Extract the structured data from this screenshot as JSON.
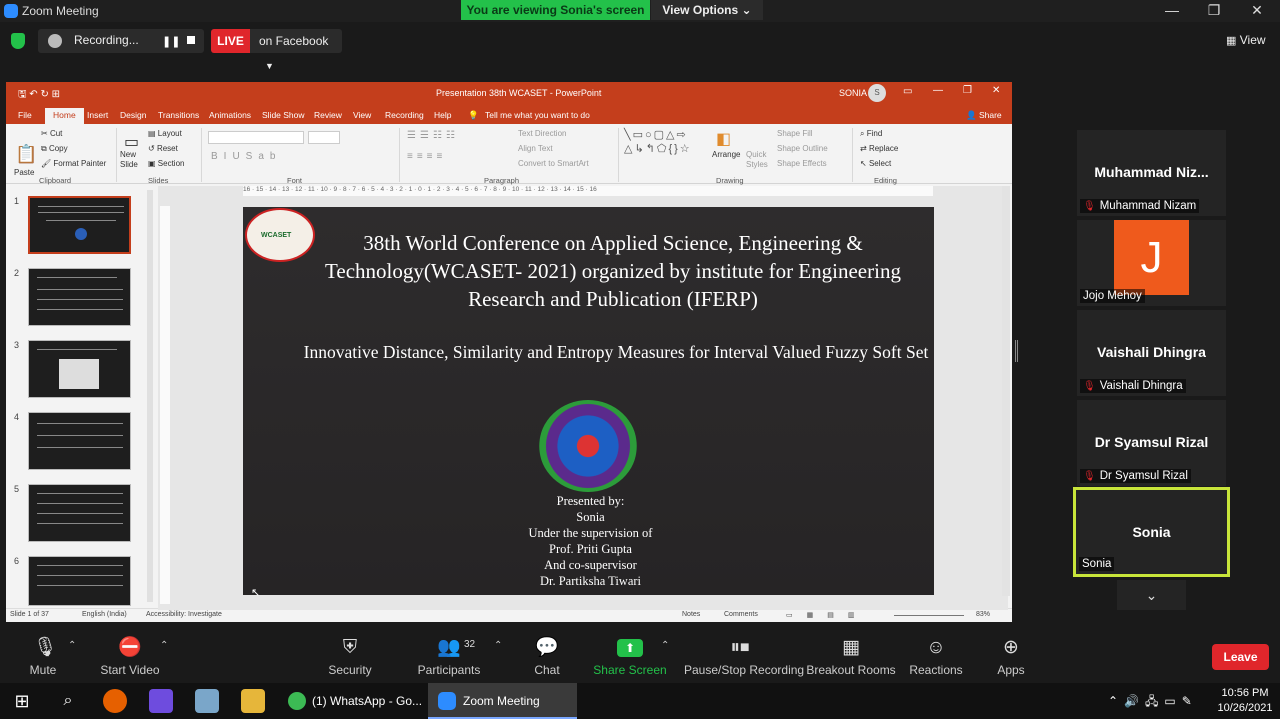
{
  "window": {
    "title": "Zoom Meeting"
  },
  "banner": {
    "viewing": "You are viewing Sonia's screen",
    "view_options": "View Options"
  },
  "status": {
    "recording": "Recording...",
    "live": "LIVE",
    "destination": "on Facebook",
    "view": "View"
  },
  "ppt": {
    "title": "Presentation 38th WCASET  -  PowerPoint",
    "user": "SONIA",
    "user_initial": "S",
    "tabs": [
      "File",
      "Home",
      "Insert",
      "Design",
      "Transitions",
      "Animations",
      "Slide Show",
      "Review",
      "View",
      "Recording",
      "Help"
    ],
    "tell_me": "Tell me what you want to do",
    "share": "Share",
    "ribbon": {
      "paste": "Paste",
      "cut": "Cut",
      "copy": "Copy",
      "format_painter": "Format Painter",
      "new_slide": "New Slide",
      "layout": "Layout",
      "reset": "Reset",
      "section": "Section",
      "text_direction": "Text Direction",
      "align_text": "Align Text",
      "convert_smartart": "Convert to SmartArt",
      "arrange": "Arrange",
      "quick_styles": "Quick Styles",
      "shape_fill": "Shape Fill",
      "shape_outline": "Shape Outline",
      "shape_effects": "Shape Effects",
      "find": "Find",
      "replace": "Replace",
      "select": "Select",
      "groups": [
        "Clipboard",
        "Slides",
        "Font",
        "Paragraph",
        "Drawing",
        "Editing"
      ]
    },
    "thumb_numbers": [
      "1",
      "2",
      "3",
      "4",
      "5",
      "6"
    ],
    "ruler": "16 · 15 · 14 · 13 · 12 · 11 · 10 · 9 · 8 · 7 · 6 · 5 · 4 · 3 · 2 · 1 · 0 · 1 · 2 · 3 · 4 · 5 · 6 · 7 · 8 · 9 · 10 · 11 · 12 · 13 · 14 · 15 · 16",
    "slide": {
      "logo_text": "WCASET",
      "title": "38th World Conference on Applied Science, Engineering  &  Technology(WCASET- 2021) organized by institute for Engineering Research and Publication (IFERP)",
      "subtitle": "Innovative Distance, Similarity and Entropy Measures for Interval Valued Fuzzy Soft Set",
      "presented_by": "Presented by:",
      "presenter": "Sonia",
      "supervision": "Under the supervision of",
      "supervisor": "Prof. Priti Gupta",
      "co": "And co-supervisor",
      "co_supervisor": "Dr. Partiksha Tiwari"
    },
    "statusbar": {
      "slide": "Slide 1 of 37",
      "language": "English (India)",
      "accessibility": "Accessibility: Investigate",
      "notes": "Notes",
      "comments": "Comments",
      "zoom": "83%"
    }
  },
  "participants": [
    {
      "display": "Muhammad  Niz...",
      "label": "Muhammad Nizam",
      "muted": true
    },
    {
      "display": "J",
      "label": "Jojo Mehoy",
      "muted": false
    },
    {
      "display": "Vaishali Dhingra",
      "label": "Vaishali Dhingra",
      "muted": true
    },
    {
      "display": "Dr Syamsul Rizal",
      "label": "Dr Syamsul Rizal",
      "muted": true
    },
    {
      "display": "Sonia",
      "label": "Sonia",
      "muted": false
    }
  ],
  "toolbar": {
    "mute": "Mute",
    "video": "Start Video",
    "security": "Security",
    "participants": "Participants",
    "participants_count": "32",
    "chat": "Chat",
    "share": "Share Screen",
    "recording": "Pause/Stop Recording",
    "breakout": "Breakout Rooms",
    "reactions": "Reactions",
    "apps": "Apps",
    "leave": "Leave"
  },
  "taskbar": {
    "whatsapp": "(1) WhatsApp - Go...",
    "zoom": "Zoom Meeting",
    "time": "10:56 PM",
    "date": "10/26/2021"
  },
  "colors": {
    "live_red": "#e0262b",
    "zoom_green": "#23c14a",
    "ppt_orange": "#c43e1c",
    "active_speaker": "#c8e53a"
  }
}
